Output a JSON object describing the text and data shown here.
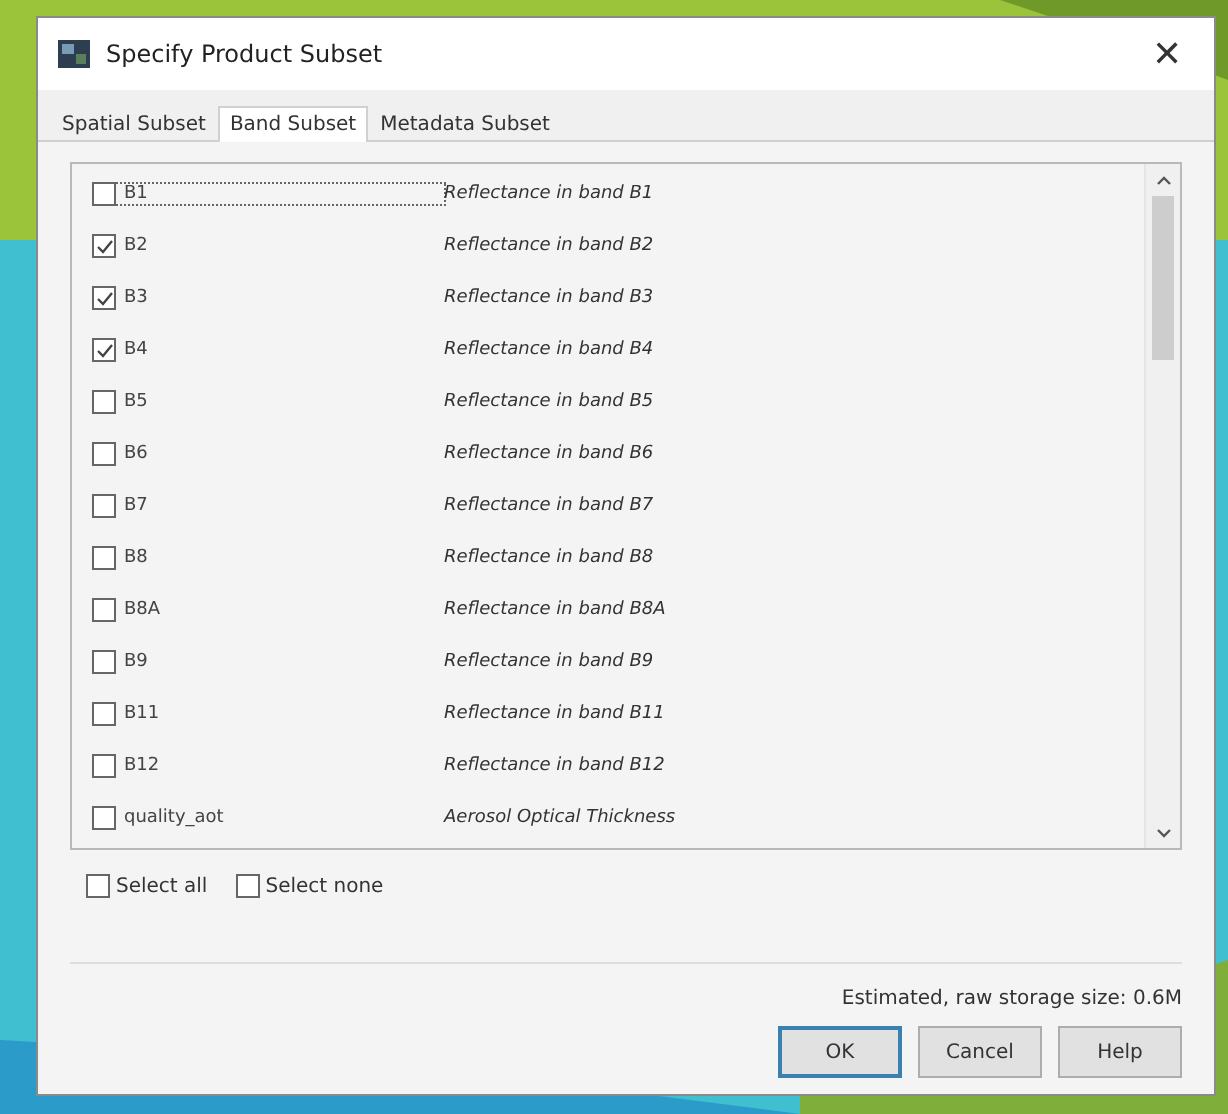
{
  "window": {
    "title": "Specify Product Subset",
    "close": "✕"
  },
  "tabs": [
    {
      "label": "Spatial Subset",
      "selected": false
    },
    {
      "label": "Band Subset",
      "selected": true
    },
    {
      "label": "Metadata Subset",
      "selected": false
    }
  ],
  "bands": [
    {
      "name": "B1",
      "description": "Reflectance in band B1",
      "checked": false,
      "focused": true
    },
    {
      "name": "B2",
      "description": "Reflectance in band B2",
      "checked": true,
      "focused": false
    },
    {
      "name": "B3",
      "description": "Reflectance in band B3",
      "checked": true,
      "focused": false
    },
    {
      "name": "B4",
      "description": "Reflectance in band B4",
      "checked": true,
      "focused": false
    },
    {
      "name": "B5",
      "description": "Reflectance in band B5",
      "checked": false,
      "focused": false
    },
    {
      "name": "B6",
      "description": "Reflectance in band B6",
      "checked": false,
      "focused": false
    },
    {
      "name": "B7",
      "description": "Reflectance in band B7",
      "checked": false,
      "focused": false
    },
    {
      "name": "B8",
      "description": "Reflectance in band B8",
      "checked": false,
      "focused": false
    },
    {
      "name": "B8A",
      "description": "Reflectance in band B8A",
      "checked": false,
      "focused": false
    },
    {
      "name": "B9",
      "description": "Reflectance in band B9",
      "checked": false,
      "focused": false
    },
    {
      "name": "B11",
      "description": "Reflectance in band B11",
      "checked": false,
      "focused": false
    },
    {
      "name": "B12",
      "description": "Reflectance in band B12",
      "checked": false,
      "focused": false
    },
    {
      "name": "quality_aot",
      "description": "Aerosol Optical Thickness",
      "checked": false,
      "focused": false
    }
  ],
  "select_options": [
    {
      "label": "Select all",
      "checked": false
    },
    {
      "label": "Select none",
      "checked": false
    }
  ],
  "storage_estimate": "Estimated, raw storage size: 0.6M",
  "buttons": [
    {
      "label": "OK",
      "default": true
    },
    {
      "label": "Cancel",
      "default": false
    },
    {
      "label": "Help",
      "default": false
    }
  ]
}
